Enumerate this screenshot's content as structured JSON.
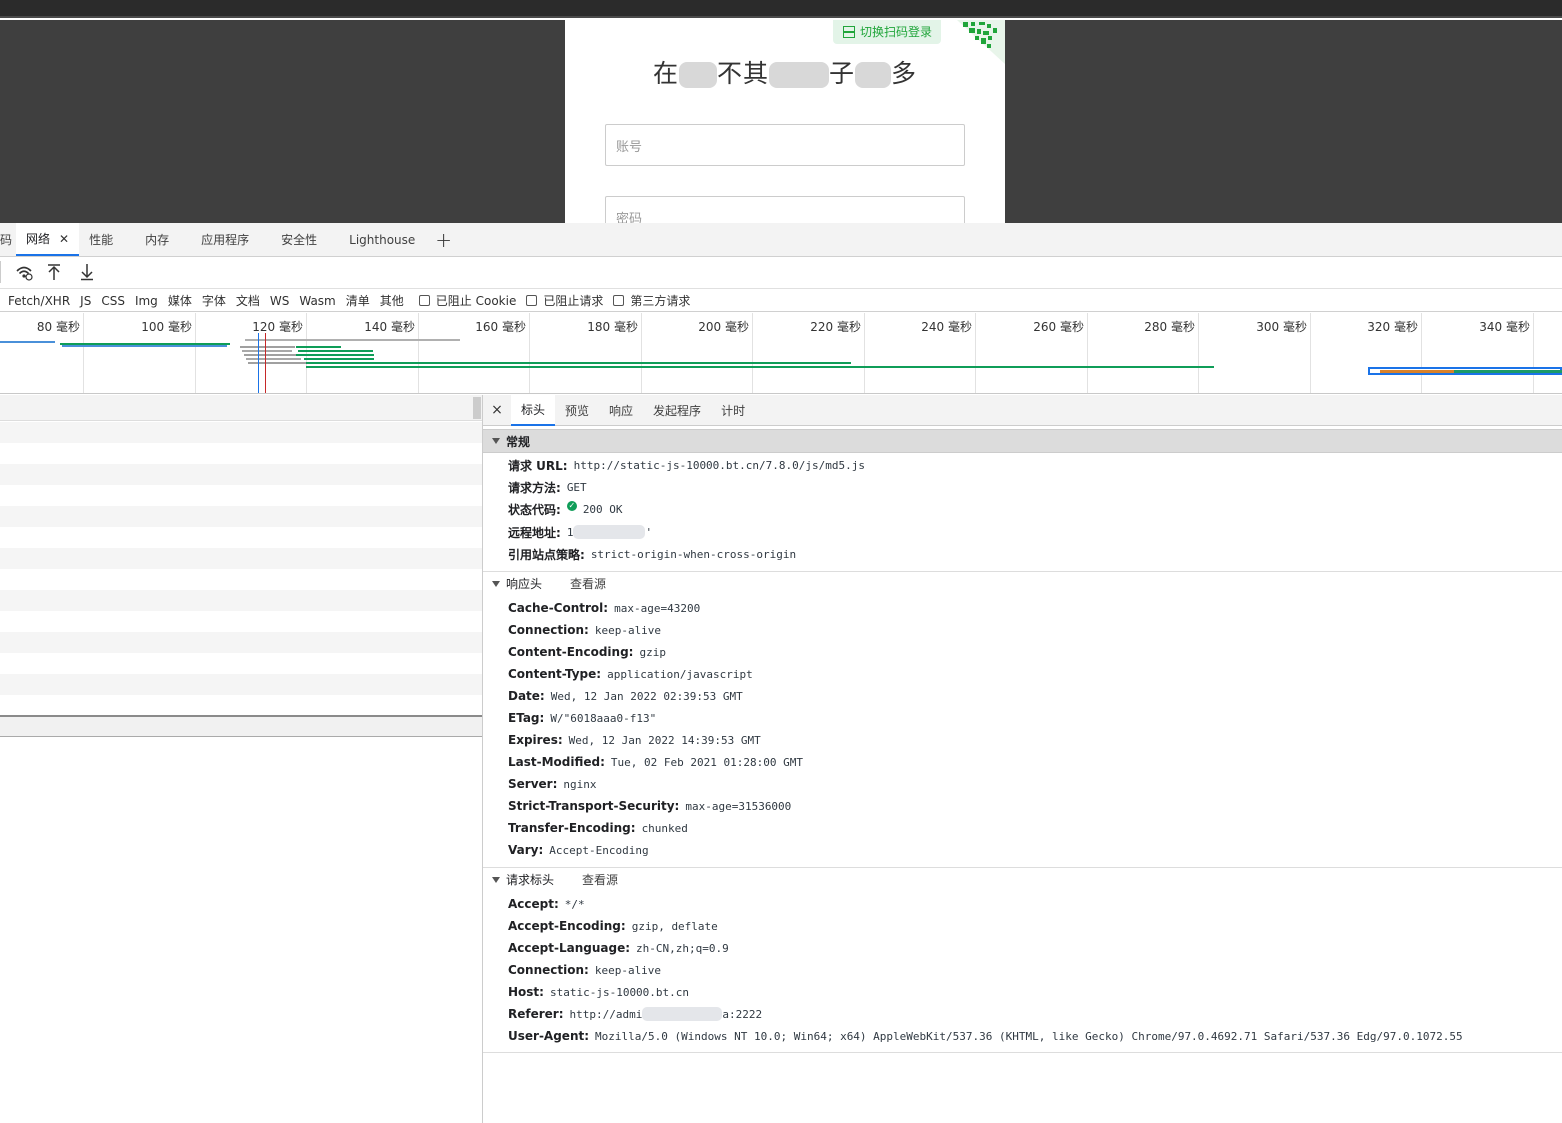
{
  "login": {
    "qr_switch_label": "切换扫码登录",
    "title_visible_chars": [
      "在",
      "不",
      "其",
      "子",
      "多"
    ],
    "account_placeholder": "账号",
    "password_placeholder": "密码"
  },
  "devtools": {
    "partial_tab": "码",
    "tabs": [
      {
        "label": "网络",
        "active": true,
        "closable": true
      },
      {
        "label": "性能"
      },
      {
        "label": "内存"
      },
      {
        "label": "应用程序"
      },
      {
        "label": "安全性"
      },
      {
        "label": "Lighthouse"
      }
    ],
    "add_tab_glyph": "+",
    "toolbar_icons": [
      "wifi-throttle-icon",
      "upload-icon",
      "download-icon"
    ],
    "filters": [
      "Fetch/XHR",
      "JS",
      "CSS",
      "Img",
      "媒体",
      "字体",
      "文档",
      "WS",
      "Wasm",
      "清单",
      "其他"
    ],
    "filter_checkboxes": [
      {
        "label": "已阻止 Cookie",
        "checked": false
      },
      {
        "label": "已阻止请求",
        "checked": false
      },
      {
        "label": "第三方请求",
        "checked": false
      }
    ],
    "timeline_ticks": [
      "80 毫秒",
      "100 毫秒",
      "120 毫秒",
      "140 毫秒",
      "160 毫秒",
      "180 毫秒",
      "200 毫秒",
      "220 毫秒",
      "240 毫秒",
      "260 毫秒",
      "280 毫秒",
      "300 毫秒",
      "320 毫秒",
      "340 毫秒"
    ]
  },
  "details": {
    "close_glyph": "×",
    "tabs": [
      {
        "label": "标头",
        "active": true
      },
      {
        "label": "预览"
      },
      {
        "label": "响应"
      },
      {
        "label": "发起程序"
      },
      {
        "label": "计时"
      }
    ],
    "general": {
      "title": "常规",
      "rows": [
        {
          "key": "请求 URL:",
          "value": "http://static-js-10000.bt.cn/7.8.0/js/md5.js"
        },
        {
          "key": "请求方法:",
          "value": "GET"
        },
        {
          "key": "状态代码:",
          "value": "200 OK",
          "status_icon": "check-circle-icon",
          "status_color": "#0f9d58"
        },
        {
          "key": "远程地址:",
          "value": "1",
          "value_tail": "'"
        },
        {
          "key": "引用站点策略:",
          "value": "strict-origin-when-cross-origin"
        }
      ]
    },
    "response_headers": {
      "title": "响应头",
      "view_source": "查看源",
      "rows": [
        {
          "key": "Cache-Control:",
          "value": "max-age=43200"
        },
        {
          "key": "Connection:",
          "value": "keep-alive"
        },
        {
          "key": "Content-Encoding:",
          "value": "gzip"
        },
        {
          "key": "Content-Type:",
          "value": "application/javascript"
        },
        {
          "key": "Date:",
          "value": "Wed, 12 Jan 2022 02:39:53 GMT"
        },
        {
          "key": "ETag:",
          "value": "W/\"6018aaa0-f13\""
        },
        {
          "key": "Expires:",
          "value": "Wed, 12 Jan 2022 14:39:53 GMT"
        },
        {
          "key": "Last-Modified:",
          "value": "Tue, 02 Feb 2021 01:28:00 GMT"
        },
        {
          "key": "Server:",
          "value": "nginx"
        },
        {
          "key": "Strict-Transport-Security:",
          "value": "max-age=31536000"
        },
        {
          "key": "Transfer-Encoding:",
          "value": "chunked"
        },
        {
          "key": "Vary:",
          "value": "Accept-Encoding"
        }
      ]
    },
    "request_headers": {
      "title": "请求标头",
      "view_source": "查看源",
      "rows": [
        {
          "key": "Accept:",
          "value": "*/*"
        },
        {
          "key": "Accept-Encoding:",
          "value": "gzip, deflate"
        },
        {
          "key": "Accept-Language:",
          "value": "zh-CN,zh;q=0.9"
        },
        {
          "key": "Connection:",
          "value": "keep-alive"
        },
        {
          "key": "Host:",
          "value": "static-js-10000.bt.cn"
        },
        {
          "key": "Referer:",
          "value": "http://admi",
          "value_tail": "a:2222"
        },
        {
          "key": "User-Agent:",
          "value": "Mozilla/5.0 (Windows NT 10.0; Win64; x64) AppleWebKit/537.36 (KHTML, like Gecko) Chrome/97.0.4692.71 Safari/537.36 Edg/97.0.1072.55"
        }
      ]
    }
  },
  "colors": {
    "accent": "#1a73e8",
    "brand_green": "#20a53a",
    "waterfall_green": "#0f9d58",
    "waterfall_blue": "#4a90d9",
    "waterfall_orange": "#d9822b"
  }
}
